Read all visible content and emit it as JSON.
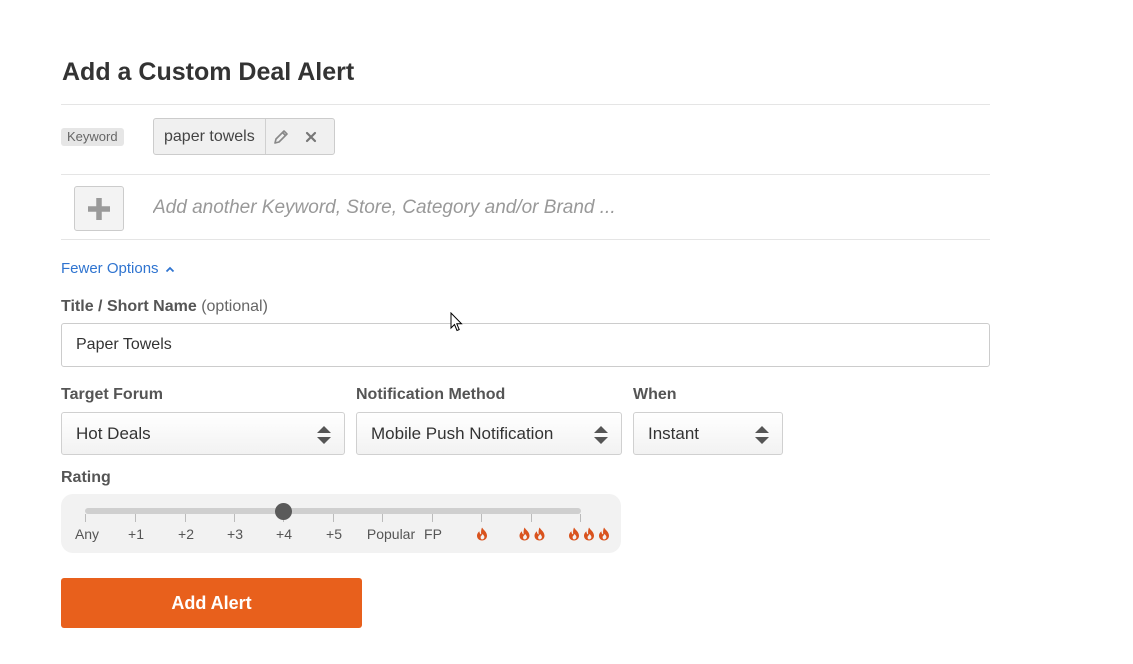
{
  "page": {
    "title": "Add a Custom Deal Alert"
  },
  "criteria": {
    "type_label": "Keyword",
    "value": "paper towels",
    "edit_icon": "pencil-icon",
    "remove_icon": "close-icon"
  },
  "add_criteria": {
    "icon": "plus-icon",
    "placeholder": "Add another Keyword, Store, Category and/or Brand ..."
  },
  "options_toggle": {
    "label": "Fewer Options",
    "icon": "chevron-up-icon"
  },
  "title_field": {
    "label": "Title / Short Name",
    "optional_label": "(optional)",
    "value": "Paper Towels"
  },
  "target_forum": {
    "label": "Target Forum",
    "selected": "Hot Deals"
  },
  "notification_method": {
    "label": "Notification Method",
    "selected": "Mobile Push Notification"
  },
  "when": {
    "label": "When",
    "selected": "Instant"
  },
  "rating": {
    "label": "Rating",
    "ticks": [
      "Any",
      "+1",
      "+2",
      "+3",
      "+4",
      "+5",
      "Popular",
      "FP"
    ],
    "flame_ticks": [
      1,
      2,
      3
    ],
    "selected": "+4",
    "flame_icon": "flame-icon"
  },
  "submit": {
    "label": "Add Alert"
  },
  "colors": {
    "accent": "#e8601c",
    "link": "#2f74d0",
    "flame": "#d9531e"
  }
}
